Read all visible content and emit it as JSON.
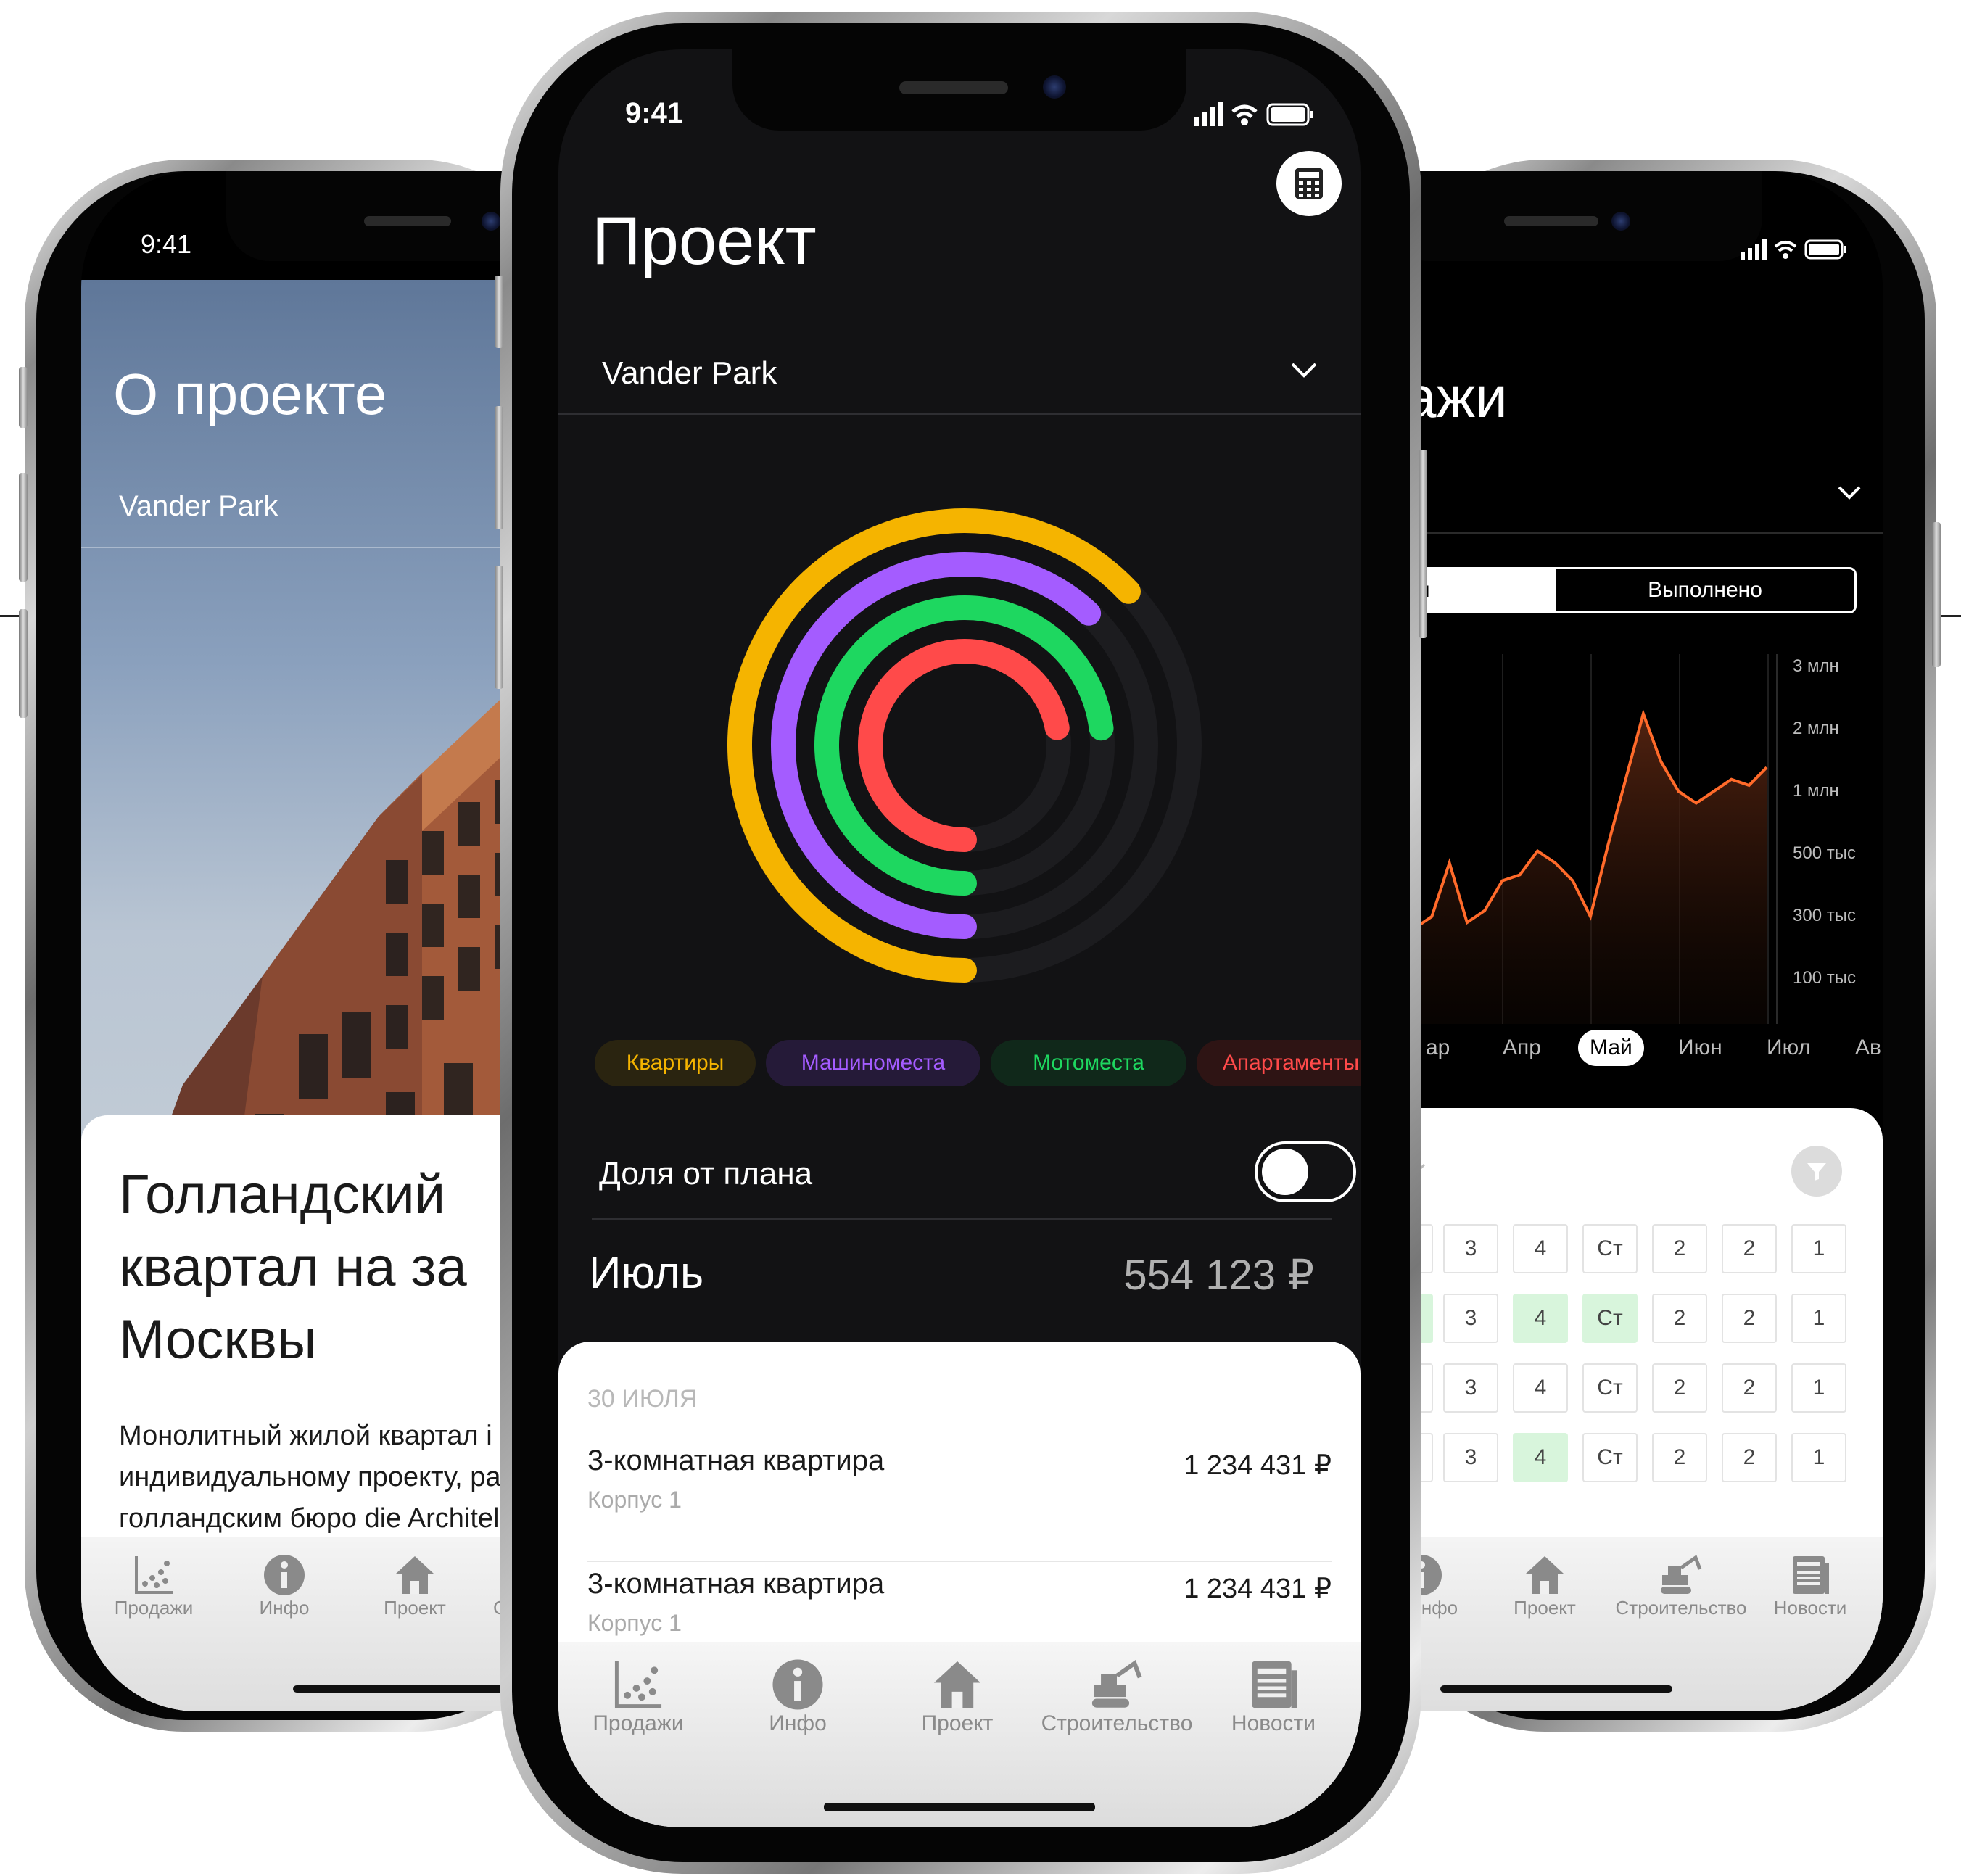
{
  "left": {
    "time": "9:41",
    "title": "О проекте",
    "project": "Vander Park",
    "heading": "Голландский квартал на за Москвы",
    "heading_lines": [
      "Голландский",
      "квартал на за",
      "Москвы"
    ],
    "desc_lines": [
      "Монолитный жилой квартал і",
      "индивидуальному проекту, ра",
      "голландским бюро die Architel"
    ],
    "tabs": [
      "Продажи",
      "Инфо",
      "Проект",
      "Ст"
    ]
  },
  "center": {
    "time": "9:41",
    "title": "Проект",
    "project": "Vander Park",
    "legend": [
      {
        "label": "Квартиры",
        "color": "#f5b400",
        "bg": "#2a2410"
      },
      {
        "label": "Машиноместа",
        "color": "#a45cff",
        "bg": "#251a38"
      },
      {
        "label": "Мотоместа",
        "color": "#1ed760",
        "bg": "#10281a"
      },
      {
        "label": "Апартаменты",
        "color": "#ff4a4a",
        "bg": "#2e1414"
      }
    ],
    "rings": [
      {
        "name": "Квартиры",
        "fraction": 0.63,
        "color": "#f5b400"
      },
      {
        "name": "Машиноместа",
        "fraction": 0.62,
        "color": "#a45cff"
      },
      {
        "name": "Мотоместа",
        "fraction": 0.73,
        "color": "#1ed760"
      },
      {
        "name": "Апартаменты",
        "fraction": 0.72,
        "color": "#ff4a4a"
      }
    ],
    "share_label": "Доля от плана",
    "share_toggle_on": false,
    "month": "Июль",
    "amount": "554 123 ₽",
    "date_header": "30 ИЮЛЯ",
    "sales": [
      {
        "title": "3-комнатная квартира",
        "sub": "Корпус 1",
        "price": "1 234 431 ₽"
      },
      {
        "title": "3-комнатная квартира",
        "sub": "Корпус 1",
        "price": "1 234 431 ₽"
      }
    ],
    "tabs": [
      "Продажи",
      "Инфо",
      "Проект",
      "Строительство",
      "Новости"
    ]
  },
  "right": {
    "title_fragment": "ажи",
    "seg_left_fragment": "н",
    "seg_right": "Выполнено",
    "tabs": [
      "нфо",
      "Проект",
      "Строительство",
      "Новости"
    ],
    "grid": [
      [
        "3",
        "4",
        "Ст",
        "2",
        "2",
        "1"
      ],
      [
        "3",
        "4",
        "Ст",
        "2",
        "2",
        "1"
      ],
      [
        "3",
        "4",
        "Ст",
        "2",
        "2",
        "1"
      ],
      [
        "3",
        "4",
        "Ст",
        "2",
        "2",
        "1"
      ]
    ],
    "grid_green": [
      [],
      [
        1,
        2
      ],
      [],
      [
        1
      ]
    ]
  },
  "chart_data": {
    "type": "area",
    "color": "#ff6a2a",
    "y_ticks": [
      "3 млн",
      "2 млн",
      "1 млн",
      "500 тыс",
      "300 тыс",
      "100 тыс"
    ],
    "x_labels": [
      "ap",
      "Апр",
      "Май",
      "Июн",
      "Июл",
      "Авг"
    ],
    "selected_x": "Май",
    "series": [
      {
        "values": [
          0.8,
          0.9,
          1.35,
          0.85,
          0.95,
          1.2,
          1.25,
          1.45,
          1.35,
          1.2,
          0.9,
          1.5,
          2.05,
          2.6,
          2.2,
          1.95,
          1.85,
          1.95,
          2.05,
          2.0,
          2.15
        ]
      }
    ],
    "ylim": [
      0,
      3.1
    ]
  }
}
